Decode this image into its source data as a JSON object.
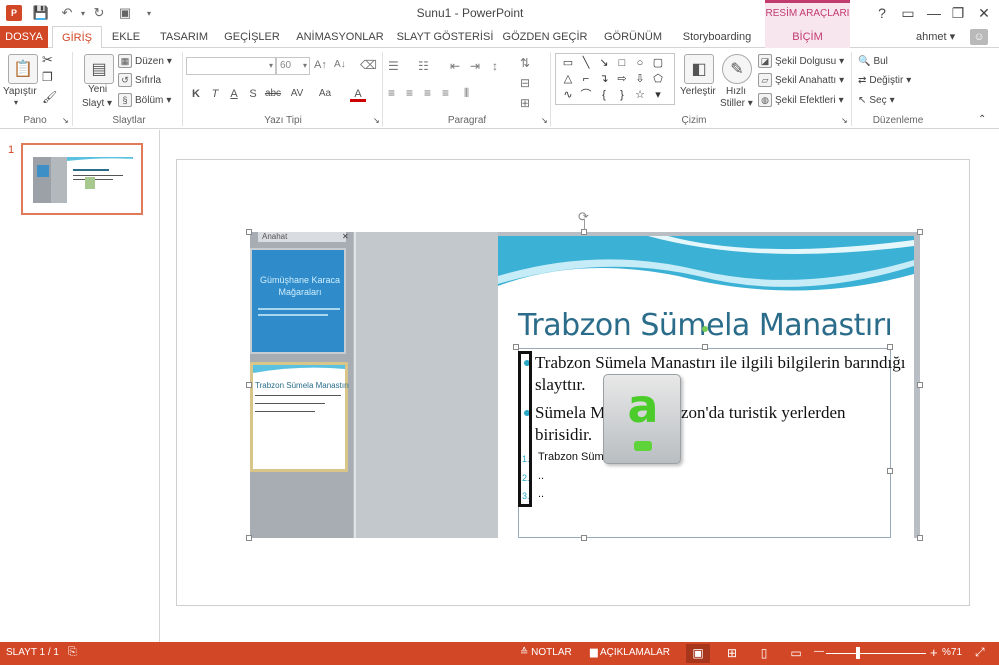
{
  "window": {
    "title": "Sunu1 - PowerPoint",
    "contextual_group": "RESİM ARAÇLARI",
    "help": "?",
    "minimize": "—",
    "restore": "❐",
    "close": "✕",
    "user": "ahmet",
    "logo": "P"
  },
  "tabs": [
    "DOSYA",
    "GİRİŞ",
    "EKLE",
    "TASARIM",
    "GEÇİŞLER",
    "ANİMASYONLAR",
    "SLAYT GÖSTERİSİ",
    "GÖZDEN GEÇİR",
    "GÖRÜNÜM",
    "Storyboarding",
    "BİÇİM"
  ],
  "ribbon": {
    "clipboard": {
      "paste": "Yapıştır",
      "label": "Pano"
    },
    "slides": {
      "new_slide_1": "Yeni",
      "new_slide_2": "Slayt",
      "layout": "Düzen",
      "reset": "Sıfırla",
      "section": "Bölüm",
      "label": "Slaytlar"
    },
    "font": {
      "font_name": "",
      "font_size": "60",
      "label": "Yazı Tipi",
      "bold": "K",
      "italic": "T",
      "underline": "A",
      "shadow": "S",
      "strike": "abc",
      "spacing": "AV",
      "case": "Aa",
      "color": "A"
    },
    "paragraph": {
      "label": "Paragraf"
    },
    "drawing": {
      "arrange_1": "Yerleştir",
      "quick_styles_1": "Hızlı",
      "quick_styles_2": "Stiller",
      "shape_fill": "Şekil Dolgusu",
      "shape_outline": "Şekil Anahattı",
      "shape_effects": "Şekil Efektleri",
      "label": "Çizim"
    },
    "editing": {
      "find": "Bul",
      "replace": "Değiştir",
      "select": "Seç",
      "label": "Düzenleme"
    }
  },
  "thumbnails": {
    "slide_number": "1"
  },
  "slide_picture": {
    "tab_label": "Anahat",
    "thumb1_title": "Gümüşhane Karaca Mağaraları",
    "thumb2_title": "Trabzon Sümela Manastırı",
    "title": "Trabzon Sümela Manastırı",
    "bullet1_line1": "Trabzon Sümela Manastırı ile ilgili bilgilerin barındığı",
    "bullet1_line2": "slayttır.",
    "bullet2_line1a": "Sümela Ma",
    "bullet2_line1b": "zon'da turistik yerlerden",
    "bullet2_line2": "birisidir.",
    "num1": "1.",
    "num2": "2.",
    "num3": "3.",
    "sub1": "Trabzon Sümela",
    "sub2": "..",
    "sub3": "..",
    "a_letter": "a"
  },
  "status": {
    "slide_info": "SLAYT 1 / 1",
    "notes": "NOTLAR",
    "comments": "AÇIKLAMALAR",
    "zoom": "%71",
    "zoom_minus": "—",
    "zoom_plus": "+"
  }
}
